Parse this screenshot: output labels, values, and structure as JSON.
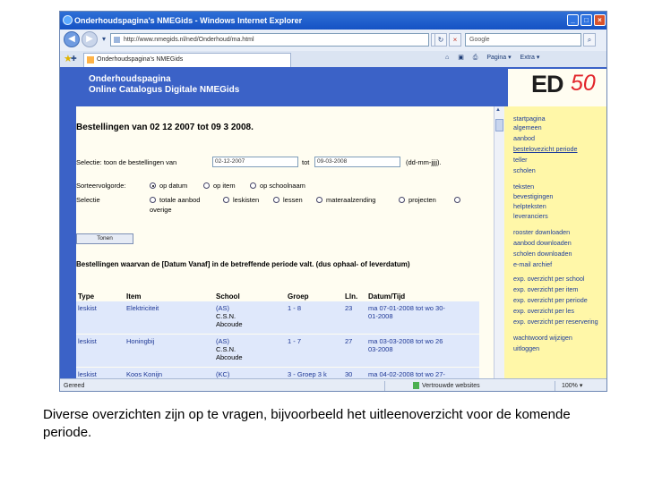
{
  "window": {
    "title": "Onderhoudspagina's NMEGids - Windows Internet Explorer",
    "address": "http://www.nmegids.nl/ned/Onderhoud/ma.html",
    "search_placeholder": "Google",
    "tab_label": "Onderhoudspagina's NMEGids",
    "toolbar": {
      "home": "⌂",
      "feeds": "▣",
      "print": "⎙",
      "page": "Pagina ▾",
      "extra": "Extra ▾"
    },
    "status_left": "Gereed",
    "status_zone": "Vertrouwde websites",
    "status_zoom": "100% ▾"
  },
  "page": {
    "header_line1": "Onderhoudspagina",
    "header_line2": "Online Catalogus Digitale NMEGids",
    "logo_text": "ED",
    "logo_number": "50",
    "heading": "Bestellingen van 02 12 2007 tot 09 3 2008.",
    "selection_prefix": "Selectie: toon de bestellingen van",
    "date_from": "02-12-2007",
    "to_label": "tot",
    "date_to": "09-03-2008",
    "date_format": "(dd-mm-jjjj).",
    "sort_label": "Sorteervolgorde:",
    "sort_options": [
      "op datum",
      "op item",
      "op schoolnaam"
    ],
    "selection_label": "Selectie",
    "selection_options": [
      "totale aanbod",
      "leskisten",
      "lessen",
      "materaalzending",
      "projecten",
      "overige"
    ],
    "show_button": "Tonen",
    "subheading": "Bestellingen waarvan de [Datum Vanaf] in de betreffende periode valt. (dus ophaal- of leverdatum)",
    "table": {
      "headers": [
        "Type",
        "Item",
        "School",
        "Groep",
        "Lln.",
        "Datum/Tijd"
      ],
      "rows": [
        {
          "type": "leskist",
          "item": "Elektriciteit",
          "school_lines": [
            "(AS)",
            "C.S.N.",
            "Abcoude"
          ],
          "groep": "1 - 8",
          "lln": "23",
          "datum_lines": [
            "ma 07-01-2008 tot wo 30-",
            "01-2008"
          ]
        },
        {
          "type": "leskist",
          "item": "Honingbij",
          "school_lines": [
            "(AS)",
            "C.S.N.",
            "Abcoude"
          ],
          "groep": "1 - 7",
          "lln": "27",
          "datum_lines": [
            "ma 03-03-2008 tot wo 26",
            "03-2008"
          ]
        },
        {
          "type": "leskist",
          "item": "Koos Konijn",
          "school_lines": [
            "(KC)"
          ],
          "groep": "3 - Groep 3 k",
          "lln": "30",
          "datum_lines": [
            "ma 04-02-2008 tot wo 27-"
          ]
        }
      ]
    }
  },
  "menu": {
    "items": [
      "startpagina",
      "algemeen",
      "aanbod",
      "bestelovezicht periode",
      "teller",
      "scholen",
      "teksten",
      "bevestigingen",
      "helpteksten",
      "leveranciers",
      "rooster downloaden",
      "aanbod downloaden",
      "scholen downloaden",
      "e-mail archief",
      "exp. overzicht per school",
      "exp. overzicht per item",
      "exp. overzicht per periode",
      "exp. overzicht per les",
      "exp. overzicht per reservering",
      "wachtwoord wijzigen",
      "uitloggen"
    ]
  },
  "caption": "Diverse overzichten zijn op te vragen, bijvoorbeeld het uitleenoverzicht voor de komende periode.",
  "colors": {
    "header_blue": "#3b62c7",
    "menu_yellow": "#fff7a8",
    "logo_red": "#e2242a",
    "row_blue": "#dfe8fb"
  }
}
